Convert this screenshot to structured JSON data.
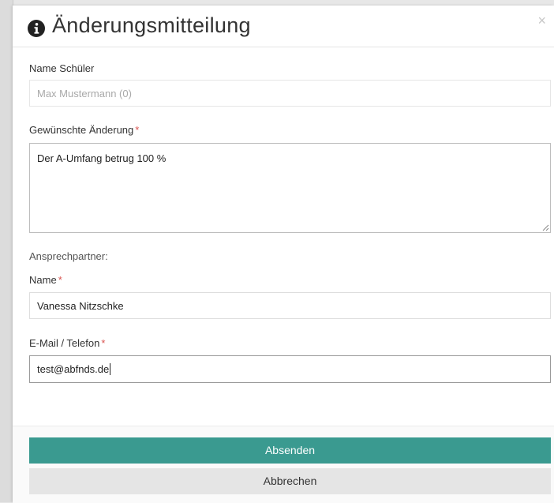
{
  "modal": {
    "title": "Änderungsmitteilung",
    "close_symbol": "×",
    "icon": "info-circle-icon"
  },
  "form": {
    "student_name": {
      "label": "Name Schüler",
      "value": "Max Mustermann (0)"
    },
    "requested_change": {
      "label": "Gewünschte Änderung",
      "required_marker": "*",
      "value": "Der A-Umfang betrug 100 %"
    },
    "contact_heading": "Ansprechpartner:",
    "contact_name": {
      "label": "Name",
      "required_marker": "*",
      "value": "Vanessa Nitzschke"
    },
    "contact_email_phone": {
      "label": "E-Mail / Telefon",
      "required_marker": "*",
      "value": "test@abfnds.de"
    }
  },
  "footer": {
    "submit_label": "Absenden",
    "cancel_label": "Abbrechen"
  },
  "colors": {
    "primary": "#3a9a90",
    "required": "#d9534f",
    "secondary_button": "#e5e5e5"
  }
}
